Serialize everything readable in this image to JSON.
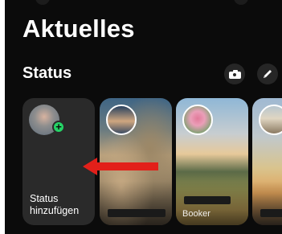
{
  "header": {
    "title": "Aktuelles"
  },
  "status": {
    "section_title": "Status",
    "camera_icon": "camera-icon",
    "pencil_icon": "pencil-icon",
    "add_card": {
      "label": "Status hinzufügen",
      "badge": "+"
    },
    "cards": [
      {
        "name": ""
      },
      {
        "name": "Booker"
      },
      {
        "name": ""
      }
    ]
  },
  "colors": {
    "background": "#0b0b0b",
    "card": "#2a2a2a",
    "accent": "#25d366",
    "arrow": "#e2201a"
  }
}
